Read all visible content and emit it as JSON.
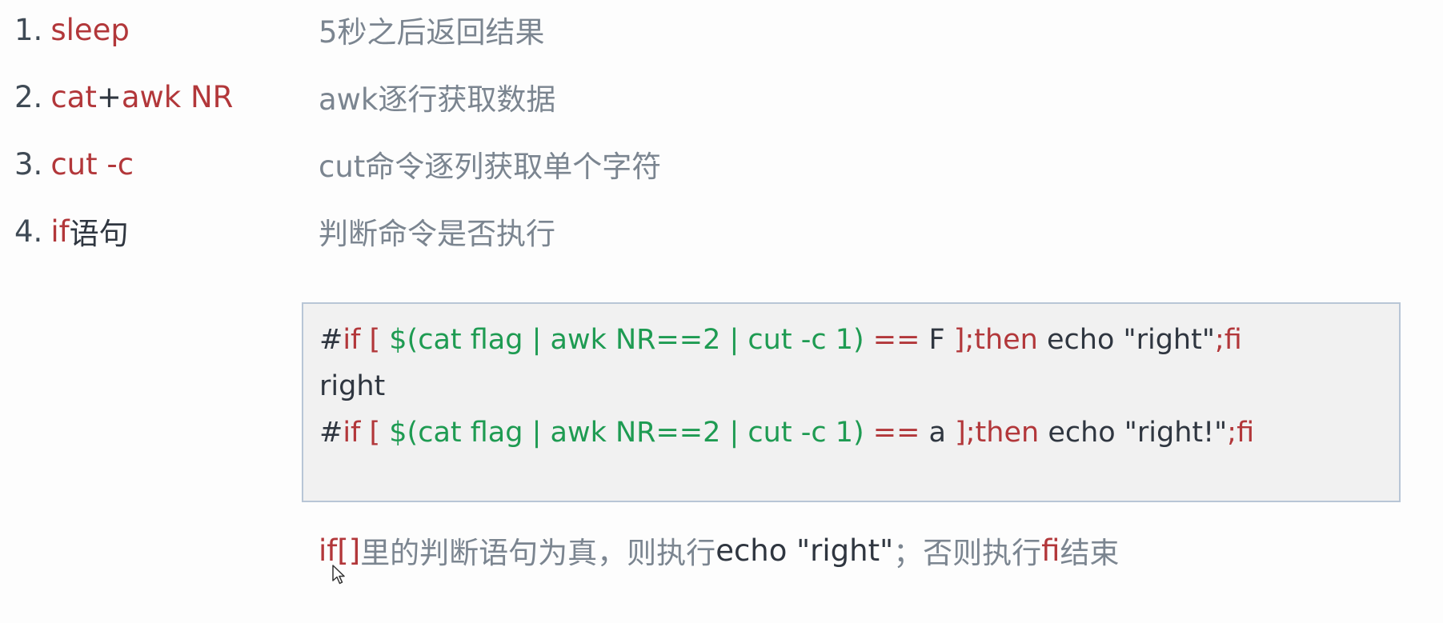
{
  "items": [
    {
      "num": "1.",
      "cmd": "sleep",
      "desc": "5秒之后返回结果"
    },
    {
      "num": "2.",
      "cmd_a": "cat",
      "plus": "+",
      "cmd_b": "awk NR",
      "desc": "awk逐行获取数据"
    },
    {
      "num": "3.",
      "cmd": "cut -c",
      "desc": "cut命令逐列获取单个字符"
    },
    {
      "num": "4.",
      "cmd_a": "if",
      "cmd_b": "语句",
      "desc": "判断命令是否执行"
    }
  ],
  "code": {
    "line1": {
      "hash": "#",
      "if_kw": "if [ ",
      "subst": "$(cat flag | awk NR==2 | cut -c 1)",
      "eq": " == ",
      "value": "F",
      "then_kw": " ];then",
      "echo": " echo \"right\"",
      "fi_kw": ";fi"
    },
    "line2": "right",
    "line3": {
      "hash": "#",
      "if_kw": "if [ ",
      "subst": "$(cat flag | awk NR==2 | cut -c 1)",
      "eq": " == ",
      "value": "a",
      "then_kw": " ];then",
      "echo": " echo \"right!\"",
      "fi_kw": ";fi"
    }
  },
  "note": {
    "if_brackets": "if[]",
    "part1": "里的判断语句为真，则执行",
    "echo": "echo \"right\"",
    "part2": "；否则执行",
    "fi": "fi",
    "part3": "结束"
  },
  "colors": {
    "keyword_red": "#b2373a",
    "string_green": "#1e9b52",
    "text_dark": "#2f3640",
    "desc_gray": "#7b8590",
    "box_border": "#b8c6d6",
    "box_bg": "#f1f1f1"
  },
  "icons": {
    "cursor": "mouse-pointer-icon"
  }
}
